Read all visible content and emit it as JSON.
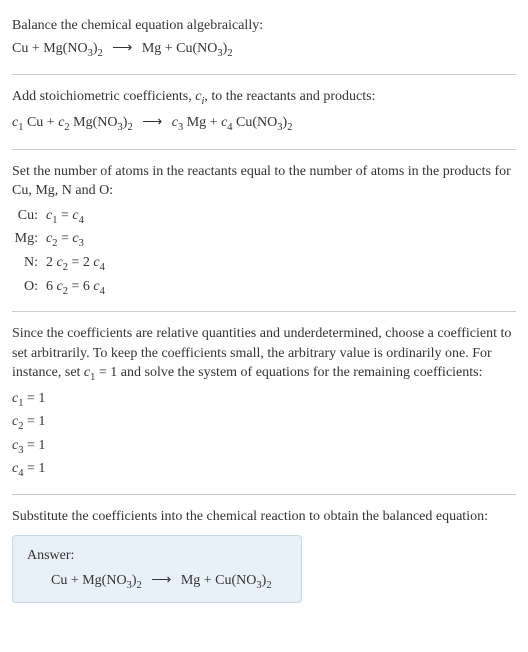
{
  "section1": {
    "title": "Balance the chemical equation algebraically:",
    "eq_left1": "Cu + Mg(NO",
    "eq_sub1": "3",
    "eq_mid1": ")",
    "eq_sub2": "2",
    "eq_arrow": "⟶",
    "eq_right1": "Mg + Cu(NO",
    "eq_sub3": "3",
    "eq_mid2": ")",
    "eq_sub4": "2"
  },
  "section2": {
    "title_a": "Add stoichiometric coefficients, ",
    "title_ci": "c",
    "title_i": "i",
    "title_b": ", to the reactants and products:",
    "c1": "c",
    "s1": "1",
    "t1": " Cu + ",
    "c2": "c",
    "s2": "2",
    "t2": " Mg(NO",
    "sub3": "3",
    "t3": ")",
    "sub2": "2",
    "arrow": "⟶",
    "c3": "c",
    "s3": "3",
    "t4": " Mg + ",
    "c4": "c",
    "s4": "4",
    "t5": " Cu(NO",
    "sub3b": "3",
    "t6": ")",
    "sub2b": "2"
  },
  "section3": {
    "title": "Set the number of atoms in the reactants equal to the number of atoms in the products for Cu, Mg, N and O:",
    "rows": [
      {
        "label": "Cu:",
        "eq_a": "c",
        "eq_s1": "1",
        "eq_m": " = ",
        "eq_b": "c",
        "eq_s2": "4",
        "pre": "",
        "pre2": ""
      },
      {
        "label": "Mg:",
        "eq_a": "c",
        "eq_s1": "2",
        "eq_m": " = ",
        "eq_b": "c",
        "eq_s2": "3",
        "pre": "",
        "pre2": ""
      },
      {
        "label": "N:",
        "eq_a": "c",
        "eq_s1": "2",
        "eq_m": " = 2 ",
        "eq_b": "c",
        "eq_s2": "4",
        "pre": "2 ",
        "pre2": ""
      },
      {
        "label": "O:",
        "eq_a": "c",
        "eq_s1": "2",
        "eq_m": " = 6 ",
        "eq_b": "c",
        "eq_s2": "4",
        "pre": "6 ",
        "pre2": ""
      }
    ]
  },
  "section4": {
    "text_a": "Since the coefficients are relative quantities and underdetermined, choose a coefficient to set arbitrarily. To keep the coefficients small, the arbitrary value is ordinarily one. For instance, set ",
    "c1": "c",
    "s1": "1",
    "text_b": " = 1 and solve the system of equations for the remaining coefficients:",
    "coefs": [
      {
        "c": "c",
        "s": "1",
        "v": " = 1"
      },
      {
        "c": "c",
        "s": "2",
        "v": " = 1"
      },
      {
        "c": "c",
        "s": "3",
        "v": " = 1"
      },
      {
        "c": "c",
        "s": "4",
        "v": " = 1"
      }
    ]
  },
  "section5": {
    "title": "Substitute the coefficients into the chemical reaction to obtain the balanced equation:",
    "answer_label": "Answer:",
    "eq_left1": "Cu + Mg(NO",
    "eq_sub1": "3",
    "eq_mid1": ")",
    "eq_sub2": "2",
    "eq_arrow": "⟶",
    "eq_right1": "Mg + Cu(NO",
    "eq_sub3": "3",
    "eq_mid2": ")",
    "eq_sub4": "2"
  }
}
